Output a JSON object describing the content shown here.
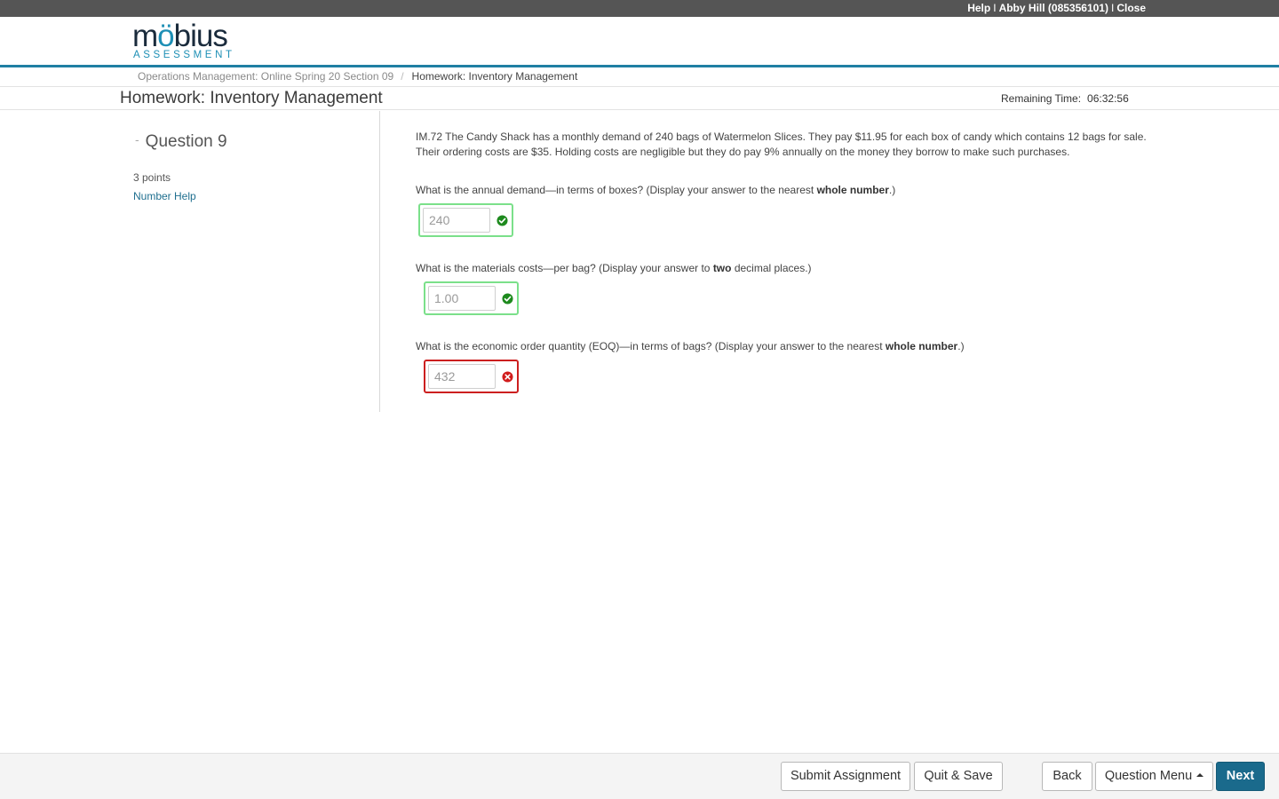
{
  "topbar": {
    "help": "Help",
    "user": "Abby Hill (085356101)",
    "close": "Close",
    "separator": "I"
  },
  "logo": {
    "word_start": "m",
    "word_oo": "ö",
    "word_b": "b",
    "word_end": "ius",
    "sub": "ASSESSMENT"
  },
  "breadcrumb": {
    "course": "Operations Management: Online Spring 20 Section 09",
    "separator": "/",
    "current": "Homework: Inventory Management"
  },
  "page": {
    "title": "Homework: Inventory Management",
    "remaining_label": "Remaining Time:",
    "remaining_value": "06:32:56"
  },
  "question": {
    "dash": "-",
    "heading": "Question 9",
    "points": "3 points",
    "number_help": "Number Help",
    "intro_line1": "IM.72  The Candy Shack has a monthly demand of 240 bags of Watermelon Slices. They pay $11.95 for each box of candy which contains 12 bags for sale.",
    "intro_line2": "Their ordering costs are $35. Holding costs are negligible but they do pay 9% annually on the money they borrow to make such purchases.",
    "parts": [
      {
        "text_before": "What is the annual demand—in terms of boxes? (Display your answer to the nearest ",
        "bold": "whole number",
        "text_after": ".)",
        "answer": "240",
        "status": "correct"
      },
      {
        "text_before": "What is the materials costs—per bag? (Display your answer to ",
        "bold": "two",
        "text_after": " decimal places.)",
        "answer": "1.00",
        "status": "correct"
      },
      {
        "text_before": "What is the economic order quantity (EOQ)—in terms of bags? (Display your answer to the nearest ",
        "bold": "whole number",
        "text_after": ".)",
        "answer": "432",
        "status": "incorrect"
      }
    ]
  },
  "footer": {
    "submit": "Submit Assignment",
    "quit": "Quit & Save",
    "back": "Back",
    "question_menu": "Question Menu",
    "next": "Next"
  },
  "colors": {
    "topbar": "#555555",
    "accent": "#1f7fa3",
    "correct_border": "#7be08a",
    "correct_icon": "#1e8a1e",
    "incorrect_border": "#cc1f1f",
    "primary_button": "#1a6a8c"
  },
  "icons": {
    "correct": "check-circle-icon",
    "incorrect": "x-circle-icon",
    "menu": "caret-up-icon"
  }
}
